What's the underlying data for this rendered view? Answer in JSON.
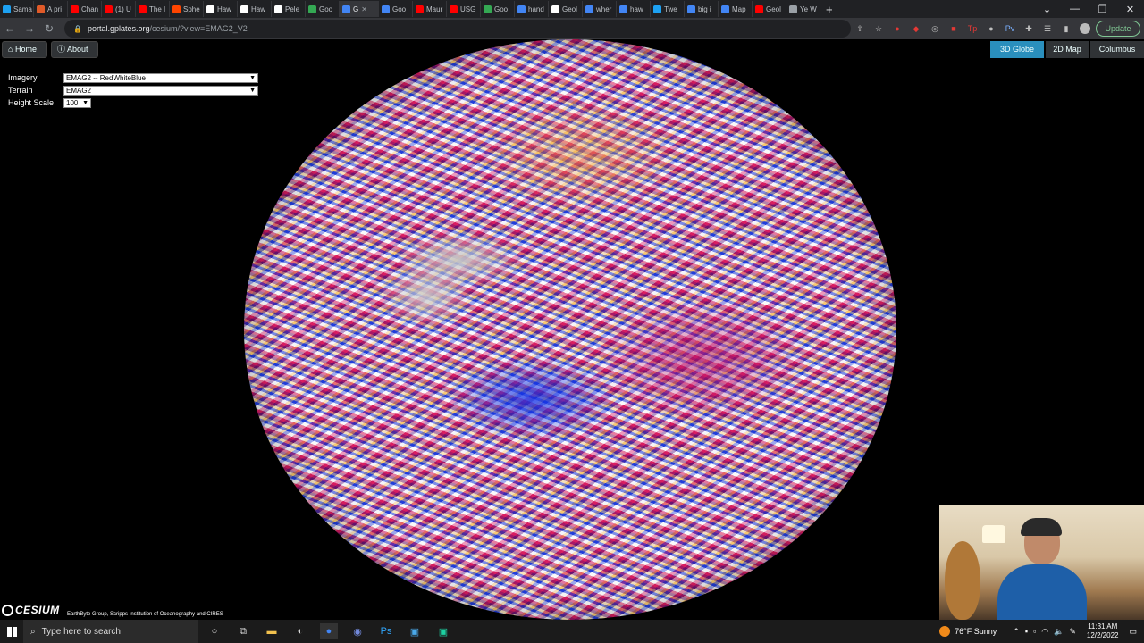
{
  "browser": {
    "tabs": [
      {
        "label": "Sama",
        "icon": "twitter-icon",
        "color": "#1da1f2"
      },
      {
        "label": "A pri",
        "icon": "e-icon",
        "color": "#e05a28"
      },
      {
        "label": "Chan",
        "icon": "youtube-icon",
        "color": "#ff0000"
      },
      {
        "label": "(1) U",
        "icon": "youtube-icon",
        "color": "#ff0000"
      },
      {
        "label": "The I",
        "icon": "youtube-icon",
        "color": "#ff0000"
      },
      {
        "label": "Sphe",
        "icon": "reddit-icon",
        "color": "#ff4500"
      },
      {
        "label": "Haw",
        "icon": "wikipedia-icon",
        "color": "#ffffff"
      },
      {
        "label": "Haw",
        "icon": "wikipedia-icon",
        "color": "#ffffff"
      },
      {
        "label": "Pele",
        "icon": "wikipedia-icon",
        "color": "#ffffff"
      },
      {
        "label": "Goo",
        "icon": "maps-icon",
        "color": "#34a853"
      },
      {
        "label": "G",
        "icon": "google-icon",
        "color": "#4285f4",
        "active": true
      },
      {
        "label": "Goo",
        "icon": "chrome-icon",
        "color": "#4285f4"
      },
      {
        "label": "Maur",
        "icon": "youtube-icon",
        "color": "#ff0000"
      },
      {
        "label": "USG",
        "icon": "youtube-icon",
        "color": "#ff0000"
      },
      {
        "label": "Goo",
        "icon": "maps-icon",
        "color": "#34a853"
      },
      {
        "label": "hand",
        "icon": "google-icon",
        "color": "#4285f4"
      },
      {
        "label": "Geol",
        "icon": "wikipedia-icon",
        "color": "#ffffff"
      },
      {
        "label": "wher",
        "icon": "google-icon",
        "color": "#4285f4"
      },
      {
        "label": "haw",
        "icon": "google-icon",
        "color": "#4285f4"
      },
      {
        "label": "Twe",
        "icon": "twitter-icon",
        "color": "#1da1f2"
      },
      {
        "label": "big i",
        "icon": "google-icon",
        "color": "#4285f4"
      },
      {
        "label": "Map",
        "icon": "google-earth-icon",
        "color": "#4285f4"
      },
      {
        "label": "Geol",
        "icon": "youtube-icon",
        "color": "#ff0000"
      },
      {
        "label": "Ye W",
        "icon": "settings-icon",
        "color": "#9aa0a6"
      }
    ],
    "url_host": "portal.gplates.org",
    "url_path": "/cesium/?view=EMAG2_V2",
    "update_label": "Update"
  },
  "viewer": {
    "home_label": "Home",
    "about_label": "About",
    "modes": [
      {
        "label": "3D Globe",
        "active": true
      },
      {
        "label": "2D Map",
        "active": false
      },
      {
        "label": "Columbus",
        "active": false
      }
    ],
    "imagery_label": "Imagery",
    "imagery_value": "EMAG2 -- RedWhiteBlue",
    "terrain_label": "Terrain",
    "terrain_value": "EMAG2",
    "height_scale_label": "Height Scale",
    "height_scale_value": "100",
    "logo_text": "CESIUM",
    "credit": "EarthByte Group, Scripps Institution of Oceanography and CIRES"
  },
  "taskbar": {
    "search_placeholder": "Type here to search",
    "weather": "76°F  Sunny",
    "time": "11:31 AM",
    "date": "12/2/2022"
  }
}
